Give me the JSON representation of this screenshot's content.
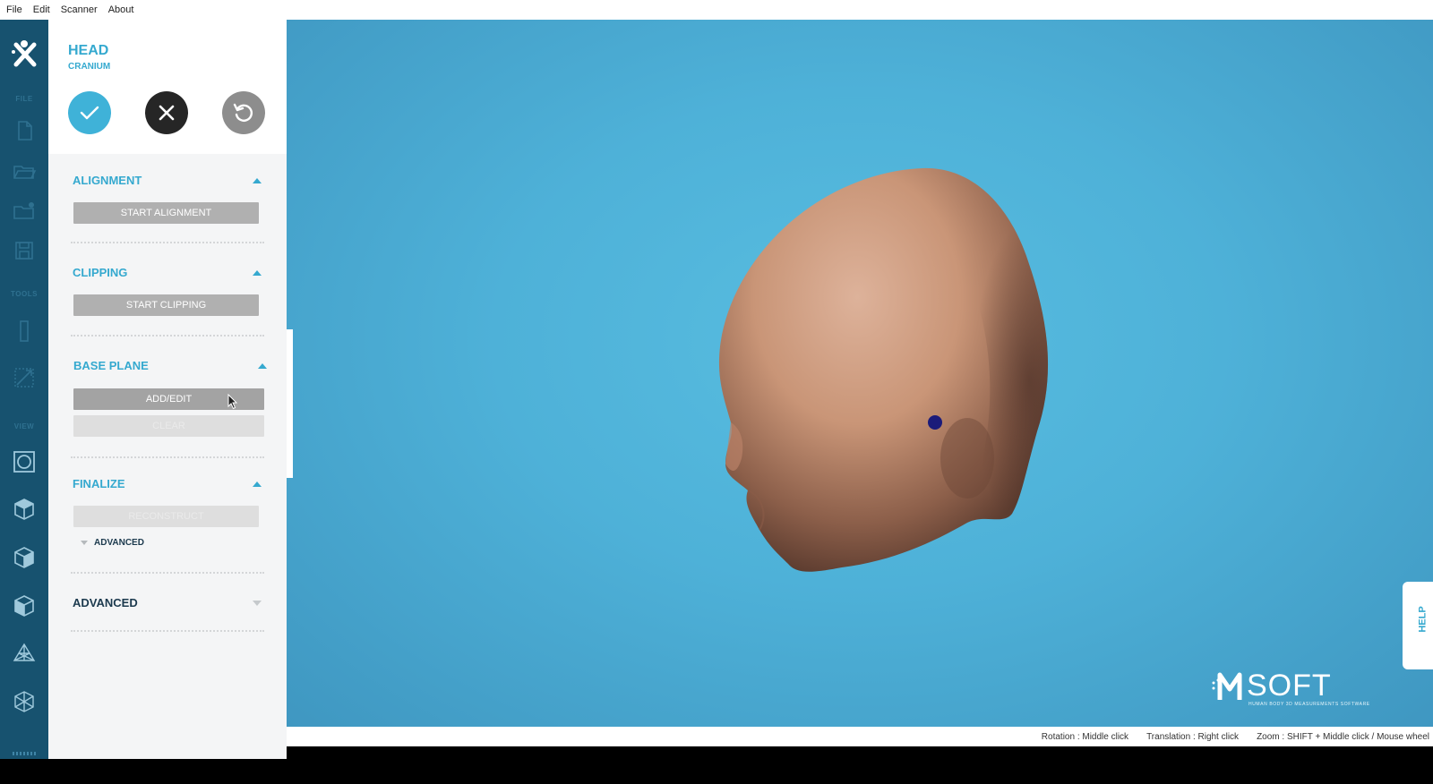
{
  "menu": {
    "file": "File",
    "edit": "Edit",
    "scanner": "Scanner",
    "about": "About"
  },
  "rail": {
    "sections": {
      "file": "FILE",
      "tools": "TOOLS",
      "view": "VIEW"
    }
  },
  "panel": {
    "title": "HEAD",
    "subtitle": "CRANIUM",
    "sections": {
      "alignment": {
        "title": "ALIGNMENT",
        "button": "START ALIGNMENT"
      },
      "clipping": {
        "title": "CLIPPING",
        "button": "START CLIPPING"
      },
      "base_plane": {
        "title": "BASE PLANE",
        "add_edit": "ADD/EDIT",
        "clear": "CLEAR"
      },
      "finalize": {
        "title": "FINALIZE",
        "reconstruct": "RECONSTRUCT",
        "advanced_sub": "ADVANCED"
      },
      "advanced": {
        "title": "ADVANCED"
      }
    }
  },
  "viewport": {
    "help": "HELP",
    "brand_name": "SOFT",
    "brand_tagline": "HUMAN BODY 3D MEASUREMENTS SOFTWARE",
    "background_color": "#4eb1d8",
    "model_color": "#cf9a80",
    "marker_color": "#1b1b7a"
  },
  "status": {
    "rotation": "Rotation : Middle click",
    "translation": "Translation : Right click",
    "zoom": "Zoom : SHIFT + Middle click / Mouse wheel"
  },
  "colors": {
    "accent": "#35a9cf",
    "rail": "#17526f",
    "panel": "#f4f5f6"
  }
}
